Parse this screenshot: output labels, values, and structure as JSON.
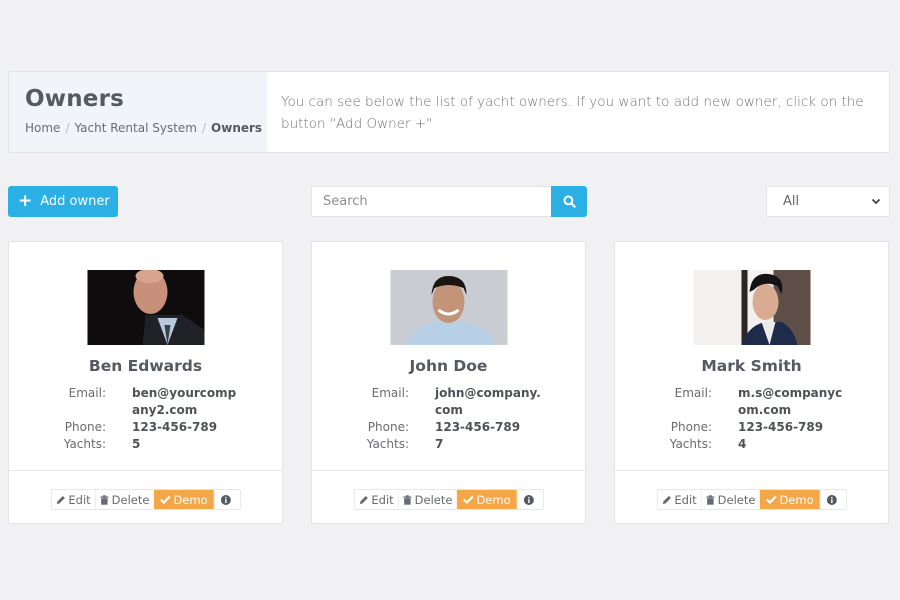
{
  "header": {
    "title": "Owners",
    "breadcrumb": [
      "Home",
      "Yacht Rental System",
      "Owners"
    ],
    "description": "You can see below the list of yacht owners. If you want to add new owner, click on the button \"Add Owner +\""
  },
  "toolbar": {
    "add_label": "Add owner",
    "search_placeholder": "Search",
    "search_value": "",
    "filter_selected": "All"
  },
  "labels": {
    "email": "Email:",
    "phone": "Phone:",
    "yachts": "Yachts:",
    "edit": "Edit",
    "delete": "Delete",
    "demo": "Demo"
  },
  "owners": [
    {
      "name": "Ben Edwards",
      "email": "ben@yourcompany2.com",
      "phone": "123-456-789",
      "yachts": "5",
      "photo": "portrait-older-man-dark-background"
    },
    {
      "name": "John Doe",
      "email": "john@company.com",
      "phone": "123-456-789",
      "yachts": "7",
      "photo": "portrait-smiling-man-light-background"
    },
    {
      "name": "Mark Smith",
      "email": "m.s@companycom.com",
      "phone": "123-456-789",
      "yachts": "4",
      "photo": "portrait-young-man-suit"
    }
  ],
  "colors": {
    "primary": "#2bb0e6",
    "demo": "#f5a647",
    "background": "#f1f1f3"
  }
}
